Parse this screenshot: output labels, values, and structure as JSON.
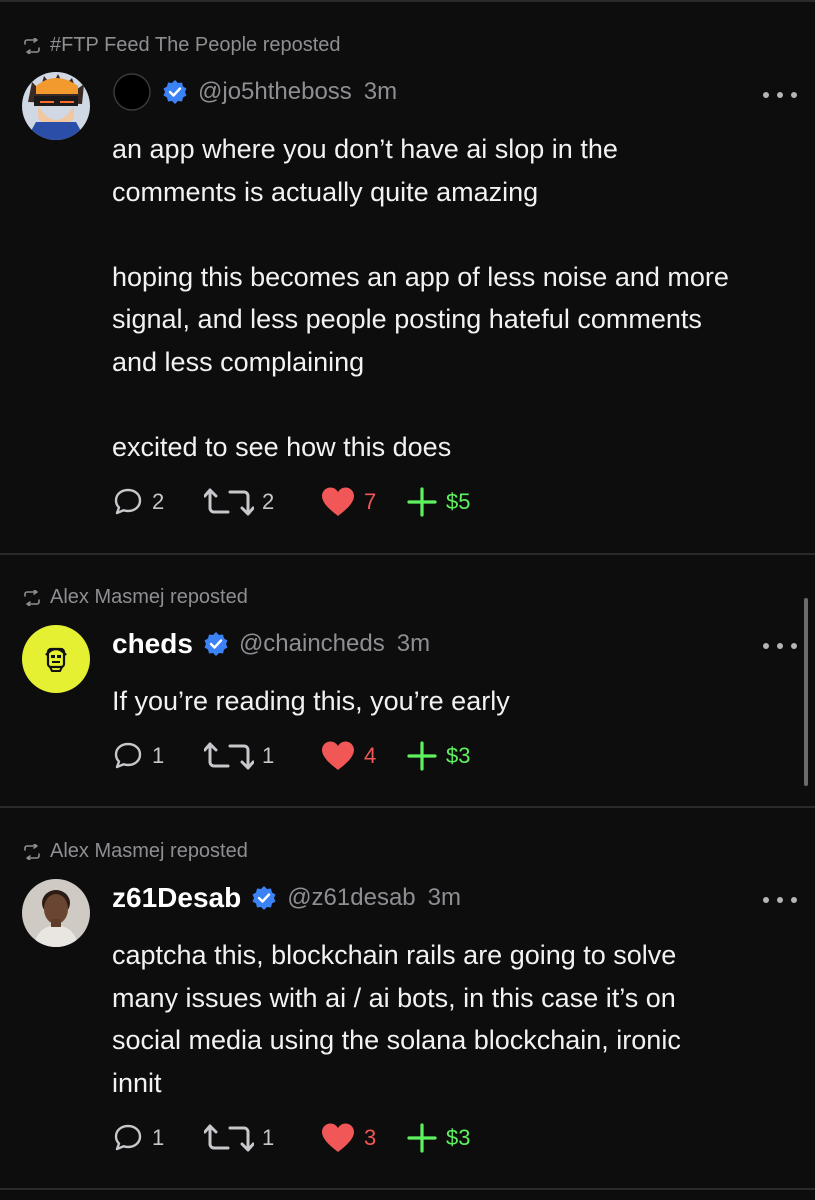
{
  "colors": {
    "background": "#0d0d0d",
    "text": "#f2f2f2",
    "muted": "#8e8e93",
    "like": "#f25757",
    "tip": "#5ef25f",
    "verified": "#3b82f6",
    "divider": "#2a2a2a"
  },
  "posts": [
    {
      "reposted_by": "#FTP Feed The People reposted",
      "display_name": "",
      "handle": "@jo5htheboss",
      "time": "3m",
      "verified": true,
      "body": "an app where you don’t have ai slop in the\ncomments is actually quite amazing\n\nhoping this becomes an app of less noise and more\nsignal, and less people posting hateful comments\nand less complaining\n\nexcited to see how this does",
      "replies": "2",
      "reposts": "2",
      "likes": "7",
      "tips": "$5",
      "avatar_icon": "anime-character-avatar"
    },
    {
      "reposted_by": "Alex Masmej reposted",
      "display_name": "cheds",
      "handle": "@chaincheds",
      "time": "3m",
      "verified": true,
      "body": "If you’re reading this, you’re early",
      "replies": "1",
      "reposts": "1",
      "likes": "4",
      "tips": "$3",
      "avatar_icon": "yellow-character-avatar"
    },
    {
      "reposted_by": "Alex Masmej reposted",
      "display_name": "z61Desab",
      "handle": "@z61desab",
      "time": "3m",
      "verified": true,
      "body": "captcha this, blockchain rails are going to solve\nmany issues with ai / ai bots, in this case it’s on\nsocial media using the solana blockchain, ironic\ninnit",
      "replies": "1",
      "reposts": "1",
      "likes": "3",
      "tips": "$3",
      "avatar_icon": "person-photo-avatar"
    }
  ]
}
